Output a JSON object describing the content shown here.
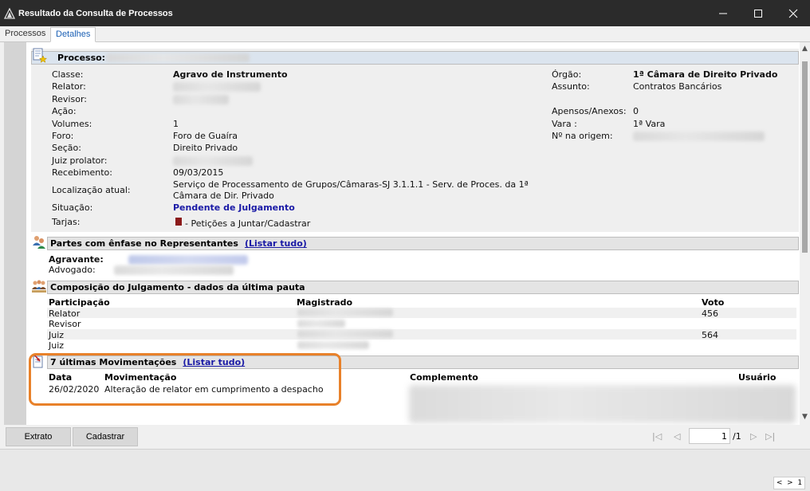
{
  "window": {
    "title": "Resultado da Consulta de Processos"
  },
  "tabs": [
    {
      "label": "Processos",
      "active": false
    },
    {
      "label": "Detalhes",
      "active": true
    }
  ],
  "processo": {
    "header_label": "Processo:",
    "left_fields": [
      {
        "label": "Classe:",
        "value": "Agravo de Instrumento",
        "style": "bold"
      },
      {
        "label": "Relator:",
        "value": ""
      },
      {
        "label": "Revisor:",
        "value": ""
      },
      {
        "label": "Ação:",
        "value": ""
      },
      {
        "label": "Volumes:",
        "value": "1"
      },
      {
        "label": "Foro:",
        "value": "Foro de Guaíra"
      },
      {
        "label": "Seção:",
        "value": "Direito Privado"
      },
      {
        "label": "Juiz prolator:",
        "value": ""
      },
      {
        "label": "Recebimento:",
        "value": "09/03/2015"
      },
      {
        "label": "Localização atual:",
        "value": "Serviço de Processamento de Grupos/Câmaras-SJ 3.1.1.1 - Serv. de Proces. da 1ª",
        "value2": "Câmara de Dir. Privado"
      },
      {
        "label": "Situação:",
        "value": "Pendente de Julgamento",
        "style": "blue"
      },
      {
        "label": "Tarjas:",
        "value": "- Petições a Juntar/Cadastrar"
      }
    ],
    "right_fields": [
      {
        "label": "Órgão:",
        "value": "1ª Câmara de Direito Privado",
        "style": "bold"
      },
      {
        "label": "Assunto:",
        "value": "Contratos Bancários"
      },
      {
        "label": "Apensos/Anexos:",
        "value": "0"
      },
      {
        "label": "Vara :",
        "value": "1ª Vara"
      },
      {
        "label": "Nº na origem:",
        "value": ""
      }
    ],
    "tarja_color": "#8b1a1a"
  },
  "partes": {
    "title": "Partes com ênfase no Representantes",
    "link": "(Listar tudo)",
    "rows": [
      {
        "label": "Agravante:"
      },
      {
        "label": "Advogado:"
      }
    ]
  },
  "composicao": {
    "title": "Composição do Julgamento - dados da última pauta",
    "columns": [
      "Participação",
      "Magistrado",
      "Voto"
    ],
    "rows": [
      {
        "participacao": "Relator",
        "voto": "456"
      },
      {
        "participacao": "Revisor",
        "voto": ""
      },
      {
        "participacao": "Juiz",
        "voto": "564"
      },
      {
        "participacao": "Juiz",
        "voto": ""
      }
    ]
  },
  "movimentacoes": {
    "title": "7 últimas Movimentações",
    "link": "(Listar tudo)",
    "columns": [
      "Data",
      "Movimentação",
      "Complemento",
      "Usuário"
    ],
    "rows": [
      {
        "data": "26/02/2020",
        "movimentacao": "Alteração de relator em cumprimento a despacho"
      }
    ]
  },
  "toolbar": {
    "extrato": "Extrato",
    "cadastrar": "Cadastrar",
    "page": "1",
    "total": "/1"
  },
  "status": {
    "page": "1"
  },
  "colors": {
    "accent": "#1a1aa6",
    "highlight": "#e8812a",
    "titlebar": "#2b2b2b"
  }
}
